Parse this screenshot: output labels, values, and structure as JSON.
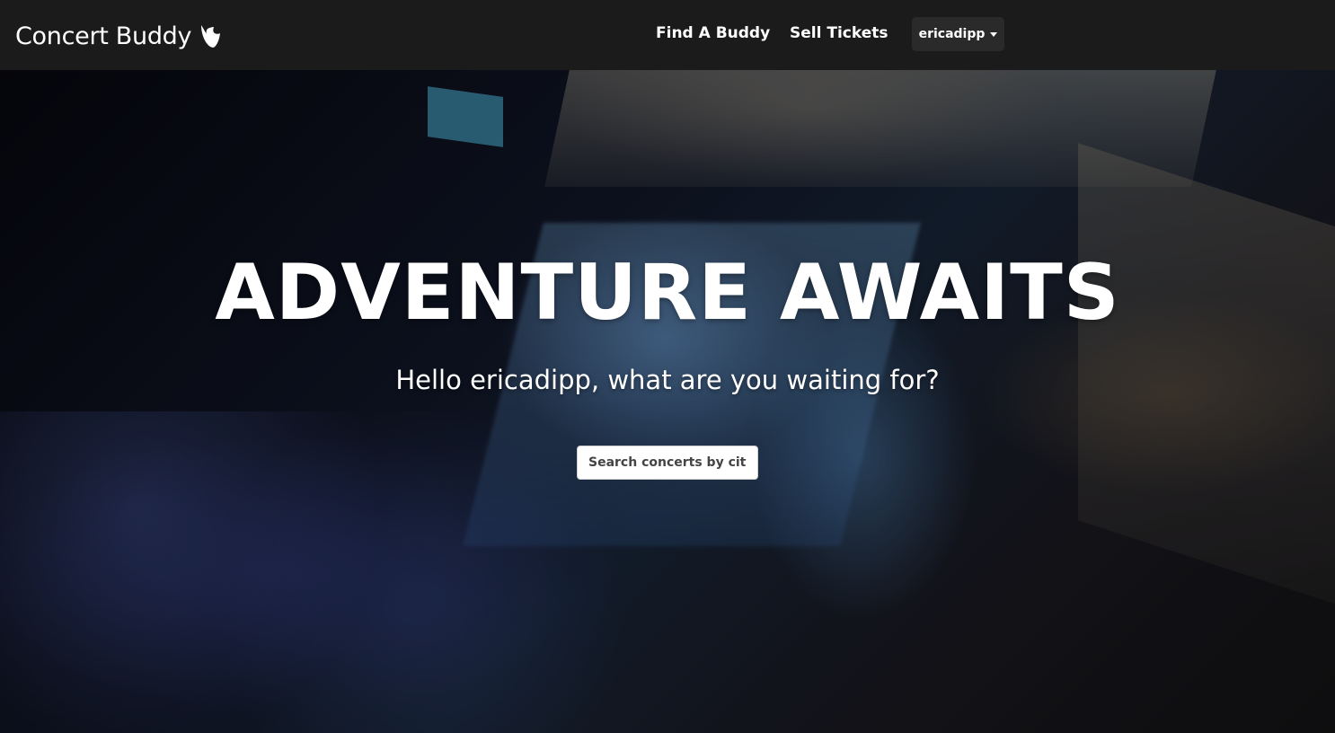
{
  "navbar": {
    "brand": "Concert Buddy",
    "brand_icon": "typo3-logo-icon",
    "links": [
      "Find A Buddy",
      "Sell Tickets"
    ],
    "user": "ericadipp"
  },
  "hero": {
    "headline": "ADVENTURE AWAITS",
    "subheadline": "Hello ericadipp, what are you waiting for?",
    "search": {
      "value": "",
      "placeholder": "Search concerts by city..."
    }
  },
  "colors": {
    "navbar_bg": "#1b1b1b",
    "dropdown_bg": "#2a2a2a",
    "text": "#ffffff"
  }
}
